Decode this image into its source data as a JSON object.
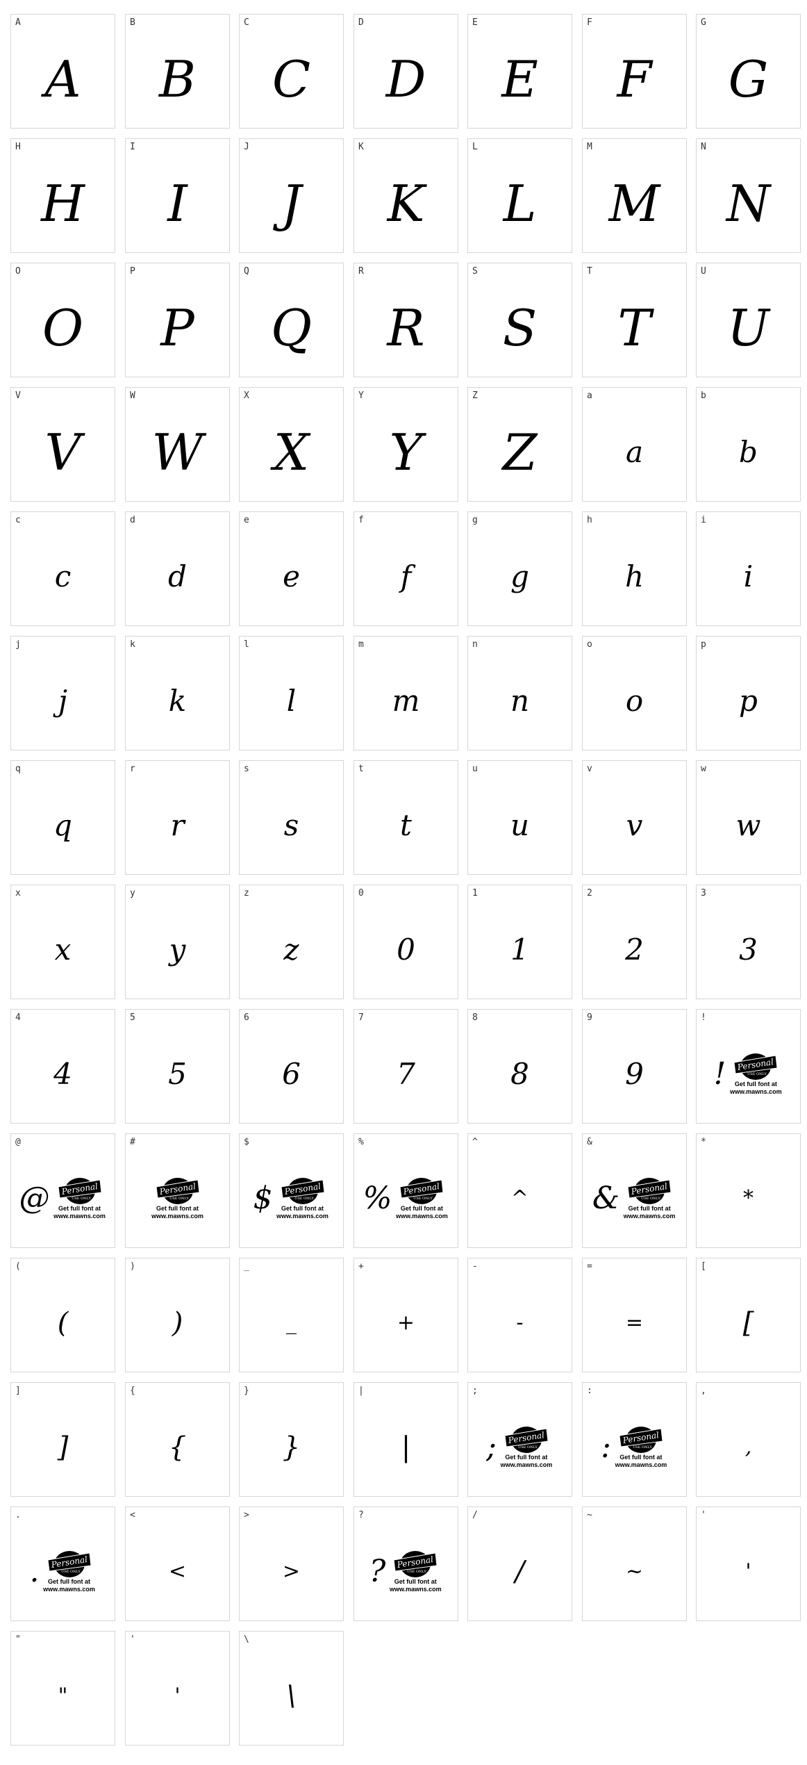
{
  "layout": {
    "columns": 7
  },
  "badge": {
    "title": "Personal",
    "subtitle": "USE ONLY",
    "line1": "Get full font at",
    "line2": "www.mawns.com"
  },
  "cells": [
    {
      "label": "A",
      "glyph": "A",
      "kind": "upper"
    },
    {
      "label": "B",
      "glyph": "B",
      "kind": "upper"
    },
    {
      "label": "C",
      "glyph": "C",
      "kind": "upper"
    },
    {
      "label": "D",
      "glyph": "D",
      "kind": "upper"
    },
    {
      "label": "E",
      "glyph": "E",
      "kind": "upper"
    },
    {
      "label": "F",
      "glyph": "F",
      "kind": "upper"
    },
    {
      "label": "G",
      "glyph": "G",
      "kind": "upper"
    },
    {
      "label": "H",
      "glyph": "H",
      "kind": "upper"
    },
    {
      "label": "I",
      "glyph": "I",
      "kind": "upper"
    },
    {
      "label": "J",
      "glyph": "J",
      "kind": "upper"
    },
    {
      "label": "K",
      "glyph": "K",
      "kind": "upper"
    },
    {
      "label": "L",
      "glyph": "L",
      "kind": "upper"
    },
    {
      "label": "M",
      "glyph": "M",
      "kind": "upper"
    },
    {
      "label": "N",
      "glyph": "N",
      "kind": "upper"
    },
    {
      "label": "O",
      "glyph": "O",
      "kind": "upper"
    },
    {
      "label": "P",
      "glyph": "P",
      "kind": "upper"
    },
    {
      "label": "Q",
      "glyph": "Q",
      "kind": "upper"
    },
    {
      "label": "R",
      "glyph": "R",
      "kind": "upper"
    },
    {
      "label": "S",
      "glyph": "S",
      "kind": "upper"
    },
    {
      "label": "T",
      "glyph": "T",
      "kind": "upper"
    },
    {
      "label": "U",
      "glyph": "U",
      "kind": "upper"
    },
    {
      "label": "V",
      "glyph": "V",
      "kind": "upper"
    },
    {
      "label": "W",
      "glyph": "W",
      "kind": "upper"
    },
    {
      "label": "X",
      "glyph": "X",
      "kind": "upper"
    },
    {
      "label": "Y",
      "glyph": "Y",
      "kind": "upper"
    },
    {
      "label": "Z",
      "glyph": "Z",
      "kind": "upper"
    },
    {
      "label": "a",
      "glyph": "a",
      "kind": "lower"
    },
    {
      "label": "b",
      "glyph": "b",
      "kind": "lower"
    },
    {
      "label": "c",
      "glyph": "c",
      "kind": "lower"
    },
    {
      "label": "d",
      "glyph": "d",
      "kind": "lower"
    },
    {
      "label": "e",
      "glyph": "e",
      "kind": "lower"
    },
    {
      "label": "f",
      "glyph": "f",
      "kind": "lower"
    },
    {
      "label": "g",
      "glyph": "g",
      "kind": "lower"
    },
    {
      "label": "h",
      "glyph": "h",
      "kind": "lower"
    },
    {
      "label": "i",
      "glyph": "i",
      "kind": "lower"
    },
    {
      "label": "j",
      "glyph": "j",
      "kind": "lower"
    },
    {
      "label": "k",
      "glyph": "k",
      "kind": "lower"
    },
    {
      "label": "l",
      "glyph": "l",
      "kind": "lower"
    },
    {
      "label": "m",
      "glyph": "m",
      "kind": "lower"
    },
    {
      "label": "n",
      "glyph": "n",
      "kind": "lower"
    },
    {
      "label": "o",
      "glyph": "o",
      "kind": "lower"
    },
    {
      "label": "p",
      "glyph": "p",
      "kind": "lower"
    },
    {
      "label": "q",
      "glyph": "q",
      "kind": "lower"
    },
    {
      "label": "r",
      "glyph": "r",
      "kind": "lower"
    },
    {
      "label": "s",
      "glyph": "s",
      "kind": "lower"
    },
    {
      "label": "t",
      "glyph": "t",
      "kind": "lower"
    },
    {
      "label": "u",
      "glyph": "u",
      "kind": "lower"
    },
    {
      "label": "v",
      "glyph": "v",
      "kind": "lower"
    },
    {
      "label": "w",
      "glyph": "w",
      "kind": "lower"
    },
    {
      "label": "x",
      "glyph": "x",
      "kind": "lower"
    },
    {
      "label": "y",
      "glyph": "y",
      "kind": "lower"
    },
    {
      "label": "z",
      "glyph": "z",
      "kind": "lower"
    },
    {
      "label": "0",
      "glyph": "0",
      "kind": "lower"
    },
    {
      "label": "1",
      "glyph": "1",
      "kind": "lower"
    },
    {
      "label": "2",
      "glyph": "2",
      "kind": "lower"
    },
    {
      "label": "3",
      "glyph": "3",
      "kind": "lower"
    },
    {
      "label": "4",
      "glyph": "4",
      "kind": "lower"
    },
    {
      "label": "5",
      "glyph": "5",
      "kind": "lower"
    },
    {
      "label": "6",
      "glyph": "6",
      "kind": "lower"
    },
    {
      "label": "7",
      "glyph": "7",
      "kind": "lower"
    },
    {
      "label": "8",
      "glyph": "8",
      "kind": "lower"
    },
    {
      "label": "9",
      "glyph": "9",
      "kind": "lower"
    },
    {
      "label": "!",
      "glyph": "!",
      "kind": "badge"
    },
    {
      "label": "@",
      "glyph": "@",
      "kind": "badge"
    },
    {
      "label": "#",
      "glyph": "",
      "kind": "badge"
    },
    {
      "label": "$",
      "glyph": "$",
      "kind": "badge"
    },
    {
      "label": "%",
      "glyph": "%",
      "kind": "badge"
    },
    {
      "label": "^",
      "glyph": "^",
      "kind": "small"
    },
    {
      "label": "&",
      "glyph": "&",
      "kind": "badge"
    },
    {
      "label": "*",
      "glyph": "*",
      "kind": "small"
    },
    {
      "label": "(",
      "glyph": "(",
      "kind": "symbol"
    },
    {
      "label": ")",
      "glyph": ")",
      "kind": "symbol"
    },
    {
      "label": "_",
      "glyph": "_",
      "kind": "small"
    },
    {
      "label": "+",
      "glyph": "+",
      "kind": "small"
    },
    {
      "label": "-",
      "glyph": "-",
      "kind": "small"
    },
    {
      "label": "=",
      "glyph": "=",
      "kind": "small"
    },
    {
      "label": "[",
      "glyph": "[",
      "kind": "symbol"
    },
    {
      "label": "]",
      "glyph": "]",
      "kind": "symbol"
    },
    {
      "label": "{",
      "glyph": "{",
      "kind": "symbol"
    },
    {
      "label": "}",
      "glyph": "}",
      "kind": "symbol"
    },
    {
      "label": "|",
      "glyph": "|",
      "kind": "symbol"
    },
    {
      "label": ";",
      "glyph": ";",
      "kind": "badge"
    },
    {
      "label": ":",
      "glyph": ":",
      "kind": "badge"
    },
    {
      "label": ",",
      "glyph": ",",
      "kind": "small"
    },
    {
      "label": ".",
      "glyph": ".",
      "kind": "badge"
    },
    {
      "label": "<",
      "glyph": "<",
      "kind": "small"
    },
    {
      "label": ">",
      "glyph": ">",
      "kind": "small"
    },
    {
      "label": "?",
      "glyph": "?",
      "kind": "badge"
    },
    {
      "label": "/",
      "glyph": "/",
      "kind": "symbol"
    },
    {
      "label": "~",
      "glyph": "~",
      "kind": "small"
    },
    {
      "label": "'",
      "glyph": "'",
      "kind": "small"
    },
    {
      "label": "\"",
      "glyph": "\"",
      "kind": "small"
    },
    {
      "label": "'",
      "glyph": "'",
      "kind": "small"
    },
    {
      "label": "\\",
      "glyph": "\\",
      "kind": "symbol"
    }
  ]
}
